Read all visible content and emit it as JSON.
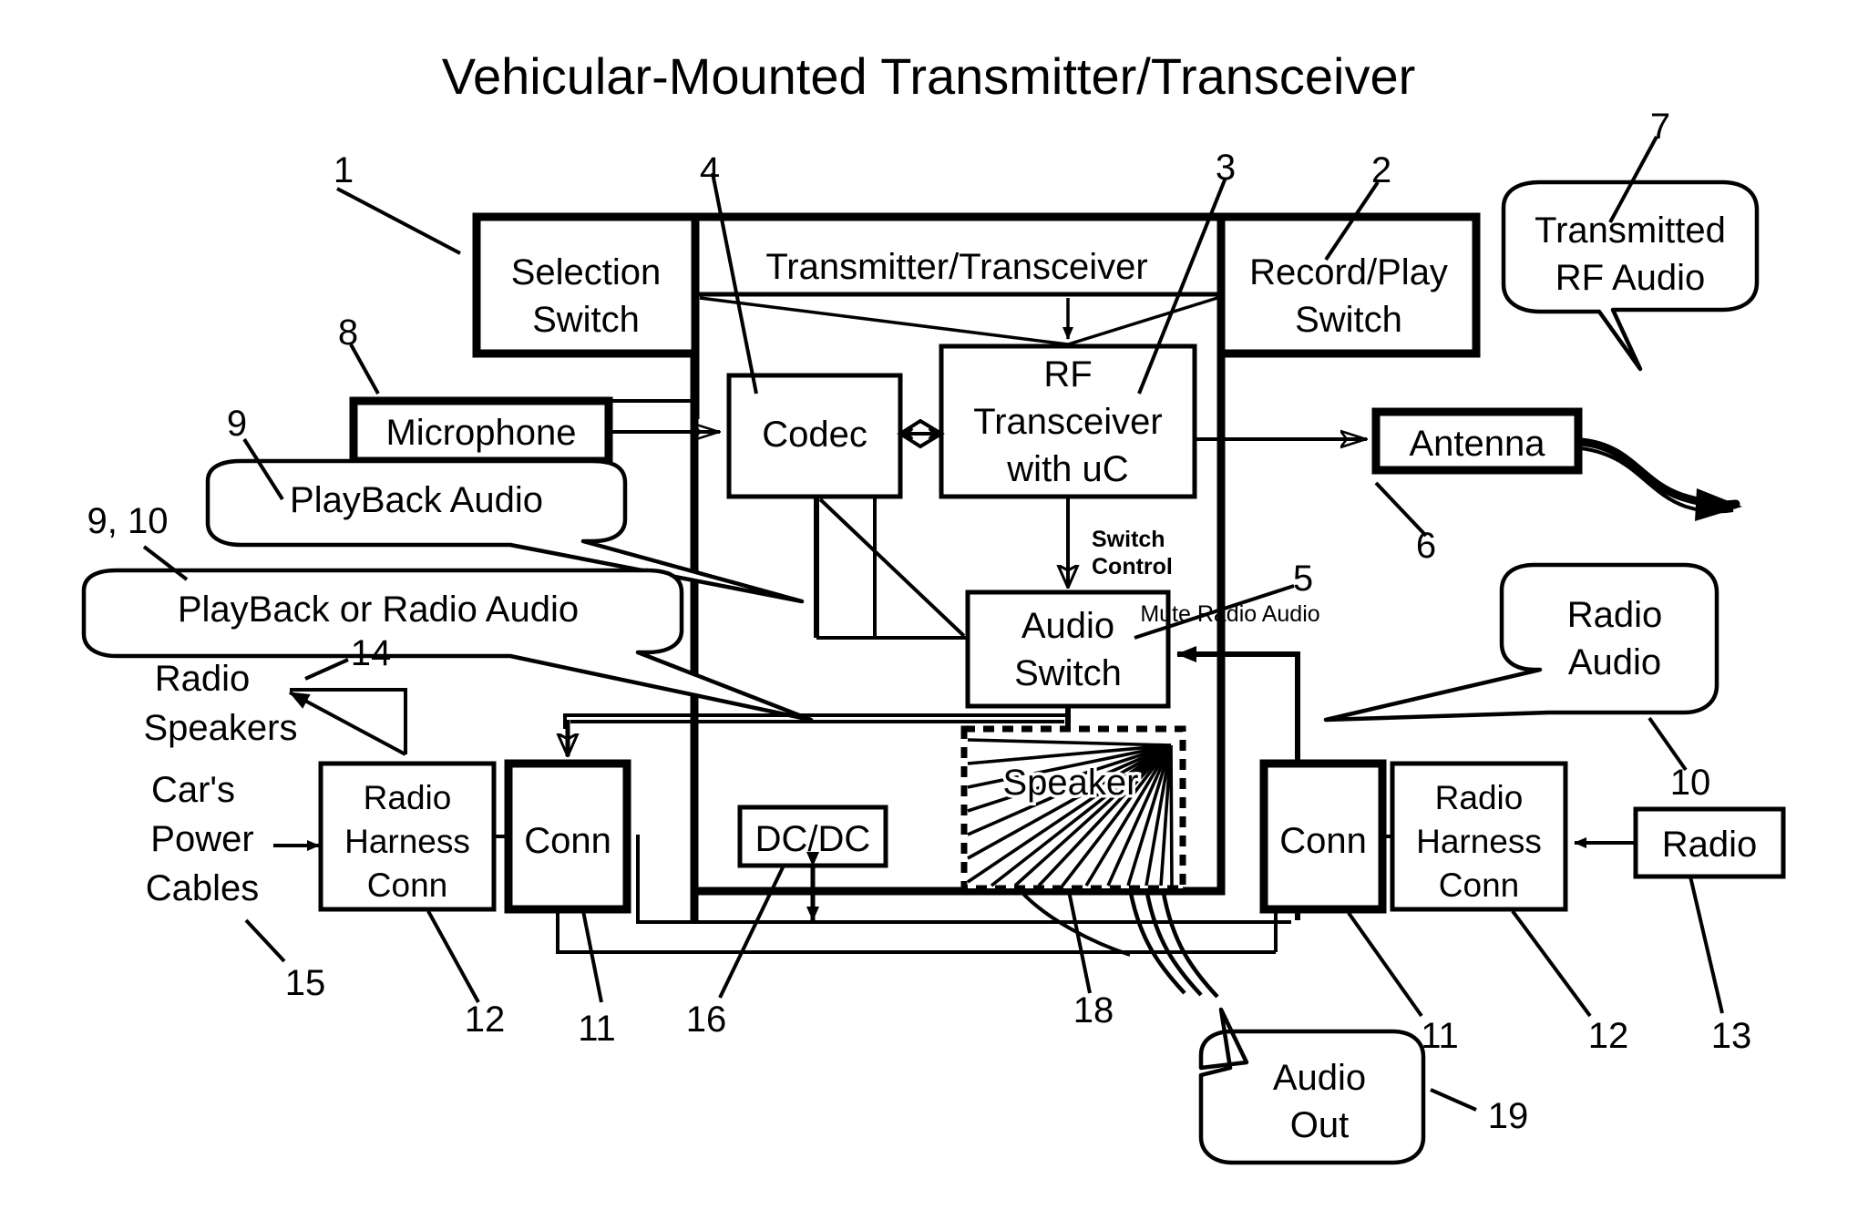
{
  "title": "Vehicular-Mounted Transmitter/Transceiver",
  "blocks": {
    "selection_switch": {
      "line1": "Selection",
      "line2": "Switch",
      "ref": "1"
    },
    "transceiver_container": {
      "label": "Transmitter/Transceiver",
      "ref": "4"
    },
    "record_play_switch": {
      "line1": "Record/Play",
      "line2": "Switch",
      "ref": "2"
    },
    "codec": {
      "label": "Codec"
    },
    "rf_transceiver": {
      "line1": "RF",
      "line2": "Transceiver",
      "line3": "with uC",
      "ref": "3"
    },
    "microphone": {
      "label": "Microphone",
      "ref": "8"
    },
    "antenna": {
      "label": "Antenna",
      "ref": "6"
    },
    "audio_switch": {
      "line1": "Audio",
      "line2": "Switch",
      "ref": "5"
    },
    "speaker": {
      "label": "Speaker",
      "ref": "18"
    },
    "dcdc": {
      "label": "DC/DC",
      "ref": "16"
    },
    "conn_left": {
      "label": "Conn",
      "ref": "11"
    },
    "conn_right": {
      "label": "Conn",
      "ref": "11"
    },
    "radio_harness_conn_left": {
      "line1": "Radio",
      "line2": "Harness",
      "line3": "Conn",
      "ref": "12"
    },
    "radio_harness_conn_right": {
      "line1": "Radio",
      "line2": "Harness",
      "line3": "Conn",
      "ref": "12"
    },
    "radio": {
      "label": "Radio",
      "ref": "13"
    }
  },
  "callouts": {
    "transmitted_rf_audio": {
      "line1": "Transmitted",
      "line2": "RF Audio",
      "ref": "7"
    },
    "playback_audio": {
      "label": "PlayBack  Audio",
      "ref": "9"
    },
    "playback_or_radio_audio": {
      "label": "PlayBack or Radio Audio",
      "ref": "9, 10"
    },
    "radio_audio": {
      "line1": "Radio",
      "line2": "Audio",
      "ref": "10"
    },
    "audio_out": {
      "line1": "Audio",
      "line2": "Out",
      "ref": "19"
    }
  },
  "labels": {
    "radio_speakers": {
      "line1": "Radio",
      "line2": "Speakers",
      "ref": "14"
    },
    "cars_power_cables": {
      "line1": "Car's",
      "line2": "Power",
      "line3": "Cables",
      "ref": "15"
    },
    "switch_control": {
      "line1": "Switch",
      "line2": "Control"
    },
    "mute_radio_audio": {
      "label": "Mute Radio Audio"
    }
  },
  "colors": {
    "ink": "#000000",
    "paper": "#ffffff"
  }
}
